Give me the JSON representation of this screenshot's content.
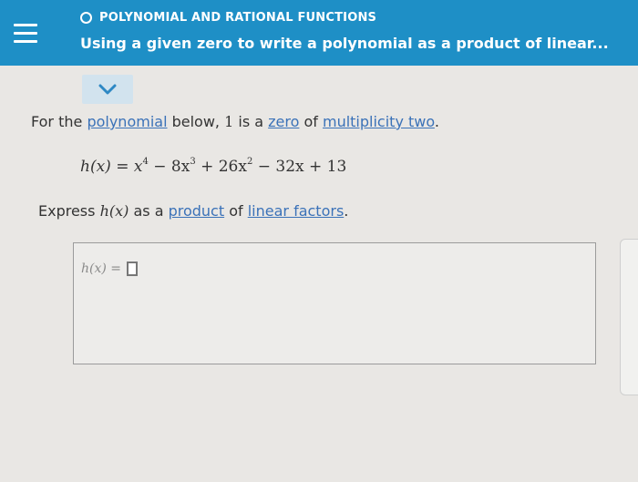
{
  "header": {
    "topic": "POLYNOMIAL AND RATIONAL FUNCTIONS",
    "title": "Using a given zero to write a polynomial as a product of linear..."
  },
  "problem": {
    "text_before": "For the ",
    "link_polynomial": "polynomial",
    "text_below": " below, ",
    "zero_value": "1",
    "text_is_a": " is a ",
    "link_zero": "zero",
    "text_of": " of ",
    "link_multiplicity": "multiplicity two",
    "period": "."
  },
  "equation": {
    "lhs": "h(x)",
    "eq": " = ",
    "t1": "x",
    "e1": "4",
    "t2": " − 8x",
    "e2": "3",
    "t3": " + 26x",
    "e3": "2",
    "t4": " − 32x + 13"
  },
  "instruction": {
    "text_express": "Express ",
    "func": "h(x)",
    "text_as_a": " as a ",
    "link_product": "product",
    "text_of": " of ",
    "link_linear_factors": "linear factors",
    "period": "."
  },
  "answer": {
    "label": "h(x) ="
  },
  "colors": {
    "header_bg": "#1e8fc6",
    "link": "#3b72b8",
    "expand_tab": "#d2e3ee"
  },
  "icons": {
    "menu": "hamburger-menu-icon",
    "topic": "circle-outline-icon",
    "expand": "chevron-down-icon"
  }
}
